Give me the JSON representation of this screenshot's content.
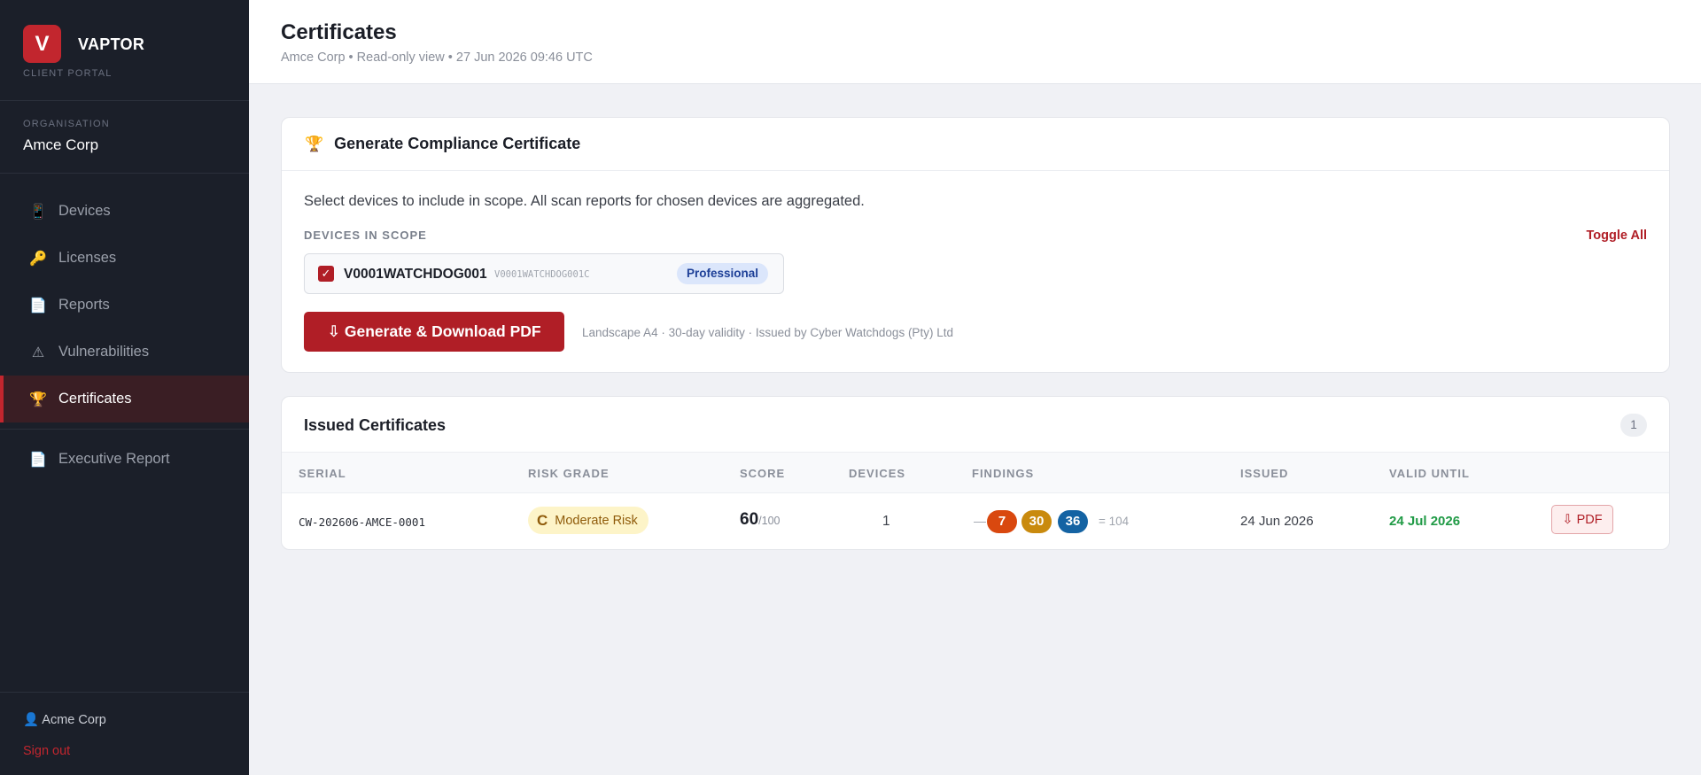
{
  "brand": {
    "logo_letter": "V",
    "name": "VAPTOR",
    "subtitle": "CLIENT PORTAL"
  },
  "organisation": {
    "label": "ORGANISATION",
    "name": "Amce Corp"
  },
  "nav": {
    "items": [
      {
        "label": "Devices",
        "icon": "📱"
      },
      {
        "label": "Licenses",
        "icon": "🔑"
      },
      {
        "label": "Reports",
        "icon": "📄"
      },
      {
        "label": "Vulnerabilities",
        "icon": "⚠"
      },
      {
        "label": "Certificates",
        "icon": "🏆"
      },
      {
        "label": "Executive Report",
        "icon": "📄"
      }
    ],
    "active": "Certificates"
  },
  "footer": {
    "user": "Acme Corp",
    "user_icon": "👤",
    "signout": "Sign out"
  },
  "header": {
    "title": "Certificates",
    "subtitle": "Amce Corp • Read-only view • 27 Jun 2026 09:46 UTC"
  },
  "generate": {
    "icon": "🏆",
    "title": "Generate Compliance Certificate",
    "description": "Select devices to include in scope. All scan reports for chosen devices are aggregated.",
    "scope_label": "DEVICES IN SCOPE",
    "toggle_all": "Toggle All",
    "devices": [
      {
        "name": "V0001WATCHDOG001",
        "id": "V0001WATCHDOG001C",
        "plan": "Professional",
        "checked": true
      }
    ],
    "button": "⇩ Generate & Download PDF",
    "note": "Landscape A4 · 30-day validity · Issued by Cyber Watchdogs (Pty) Ltd"
  },
  "issued": {
    "title": "Issued Certificates",
    "count": "1",
    "columns": [
      "SERIAL",
      "RISK GRADE",
      "SCORE",
      "DEVICES",
      "FINDINGS",
      "ISSUED",
      "VALID UNTIL"
    ],
    "rows": [
      {
        "serial": "CW-202606-AMCE-0001",
        "grade": "C",
        "risk": "Moderate Risk",
        "score": "60",
        "score_max": "/100",
        "devices": "1",
        "findings_dash": "—",
        "findings": [
          {
            "value": "7",
            "color": "#d9480f"
          },
          {
            "value": "30",
            "color": "#c98a0e"
          },
          {
            "value": "36",
            "color": "#1463a3"
          }
        ],
        "findings_total": "= 104",
        "issued": "24 Jun 2026",
        "valid_until": "24 Jul 2026",
        "pdf": "⇩ PDF"
      }
    ]
  },
  "colors": {
    "accent": "#b01e26",
    "sidebar": "#1b1f29",
    "valid": "#1f9a45"
  }
}
